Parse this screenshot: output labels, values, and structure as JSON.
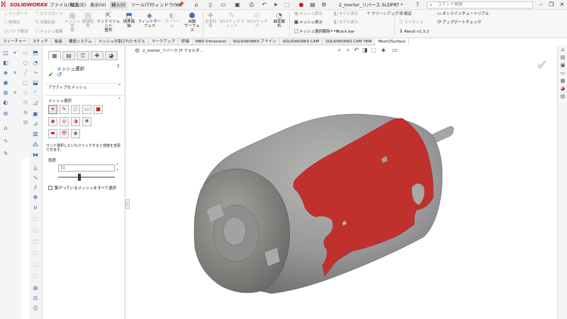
{
  "titlebar": {
    "brand": "SOLIDWORKS",
    "menus": [
      "ファイル(F)",
      "編集(E)",
      "表示(V)",
      "挿入(I)",
      "ツール(T)",
      "ウィンドウ(W)"
    ],
    "active_menu": "挿入(I)",
    "doc_title": "2_mortor_リバース.SLDPRT *",
    "search_placeholder": "コマンド検索"
  },
  "ribbon": {
    "col1": [
      "インポート",
      "削除化",
      "パイプ解決"
    ],
    "col2": [
      "エクスポート",
      "法線反転",
      "メッシュ編集"
    ],
    "btn1": "メッシュ修\n復",
    "btn2": "面積密\n度",
    "btn3": "インテリジェント\n整列",
    "btn4": "境界面\n抽",
    "btn5": "フィットサーフェス",
    "btn6": "ブーリーム",
    "btn7": "自動\nサーフェス",
    "btn8": "交差利用",
    "btn9": "3Dスケッチフィット",
    "btn10": "3Dスケッチ穴",
    "btn11": "曲率解析",
    "col3": [
      "メッシュ表示",
      "メッシュ表示",
      "メッシュ選択解除"
    ],
    "col4": [
      "モデル表示",
      "モデル表示"
    ],
    "cleanup": "クリーンアップ",
    "quickbar": "Quick bar",
    "settings": "設定",
    "license": "ライセンス",
    "about": "About v1.3.2",
    "tutorial": "オンラインチュートリアル",
    "update": "アップデートチェック"
  },
  "tabs": [
    "フィーチャー",
    "スケッチ",
    "板金",
    "構造システム",
    "メッシュ分割されたモデル",
    "マークアップ",
    "評価",
    "MBD Dimension",
    "SOLIDWORKS アドイン",
    "SOLIDWORKS CAM",
    "SOLIDWORKS CAM TBM",
    "Mesh2Surface"
  ],
  "active_tab": "Mesh2Surface",
  "pm": {
    "title": "メッシュ選択",
    "section1": "アクティブなメッシュ",
    "section2": "メッシュ選択",
    "note": "ワンド選択したいなクリックすると感度を変更できます。",
    "sensitivity_label": "感度",
    "sensitivity_value": "31",
    "sensitivity_level": 0.38,
    "checkbox_label": "繋がっているメッシュをすべて選択"
  },
  "viewport": {
    "tree_item": "2_mortor_リバース (F フォルダ..."
  },
  "colors": {
    "brand": "#c8102e",
    "mesh": "#9c9c98",
    "selection": "#c0312e"
  }
}
